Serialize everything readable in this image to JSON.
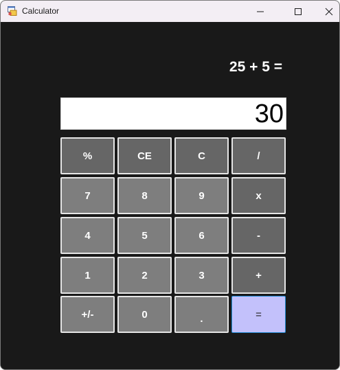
{
  "window": {
    "title": "Calculator",
    "minimize_icon": "minimize-icon",
    "maximize_icon": "maximize-icon",
    "close_icon": "close-icon"
  },
  "calculator": {
    "expression": "25 + 5 =",
    "display_value": "30",
    "keys": [
      [
        "%",
        "CE",
        "C",
        "/"
      ],
      [
        "7",
        "8",
        "9",
        "x"
      ],
      [
        "4",
        "5",
        "6",
        "-"
      ],
      [
        "1",
        "2",
        "3",
        "+"
      ],
      [
        "+/-",
        "0",
        ".",
        "="
      ]
    ]
  },
  "colors": {
    "background": "#191919",
    "operator_key": "#666666",
    "number_key": "#7e7e7e",
    "equals_key": "#c3c1fb",
    "equals_border": "#1f8ad2"
  }
}
